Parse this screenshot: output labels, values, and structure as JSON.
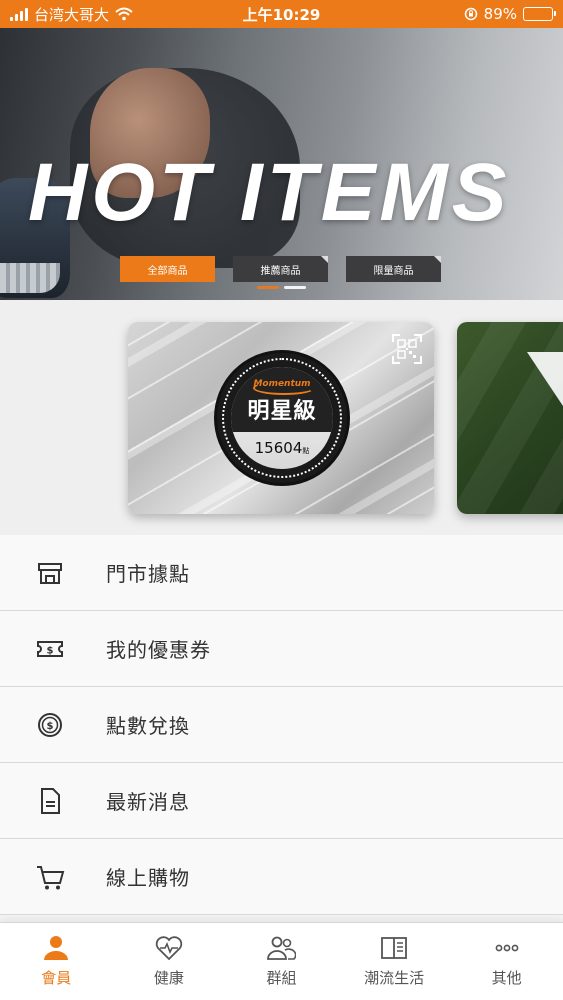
{
  "status_bar": {
    "carrier": "台湾大哥大",
    "time": "上午10:29",
    "battery": "89%",
    "battery_level": 0.89
  },
  "banner": {
    "title": "HOT ITEMS",
    "tabs": [
      {
        "label": "全部商品",
        "active": true
      },
      {
        "label": "推薦商品",
        "active": false
      },
      {
        "label": "限量商品",
        "active": false
      }
    ]
  },
  "member_card": {
    "brand": "Momentum",
    "tier": "明星級",
    "points": "15604",
    "points_unit": "點"
  },
  "menu": {
    "items": [
      {
        "label": "門市據點",
        "icon": "store-icon"
      },
      {
        "label": "我的優惠券",
        "icon": "coupon-icon"
      },
      {
        "label": "點數兌換",
        "icon": "coin-icon"
      },
      {
        "label": "最新消息",
        "icon": "document-icon"
      },
      {
        "label": "線上購物",
        "icon": "cart-icon"
      }
    ]
  },
  "bottom_nav": {
    "items": [
      {
        "label": "會員",
        "icon": "member-icon",
        "active": true
      },
      {
        "label": "健康",
        "icon": "heart-pulse-icon",
        "active": false
      },
      {
        "label": "群組",
        "icon": "group-icon",
        "active": false
      },
      {
        "label": "潮流生活",
        "icon": "book-icon",
        "active": false
      },
      {
        "label": "其他",
        "icon": "more-icon",
        "active": false
      }
    ]
  },
  "colors": {
    "accent": "#ec7a18",
    "text": "#333333"
  }
}
